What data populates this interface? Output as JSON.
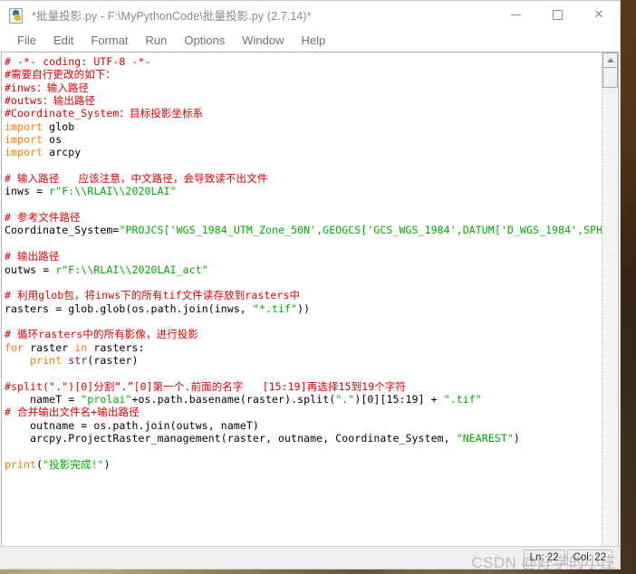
{
  "window": {
    "title": "*批量投影.py - F:\\MyPythonCode\\批量投影.py (2.7.14)*",
    "app_icon": "python-file-icon",
    "controls": {
      "minimize": "minimize-icon",
      "maximize": "maximize-icon",
      "close": "✕"
    }
  },
  "menubar": {
    "items": [
      {
        "label": "File"
      },
      {
        "label": "Edit"
      },
      {
        "label": "Format"
      },
      {
        "label": "Run"
      },
      {
        "label": "Options"
      },
      {
        "label": "Window"
      },
      {
        "label": "Help"
      }
    ]
  },
  "editor": {
    "lines": [
      [
        {
          "t": "# -*- coding: UTF-8 -*-",
          "c": "c-com"
        }
      ],
      [
        {
          "t": "#需要自行更改的如下：",
          "c": "c-com"
        }
      ],
      [
        {
          "t": "#inws：输入路径",
          "c": "c-com"
        }
      ],
      [
        {
          "t": "#outws：输出路径",
          "c": "c-com"
        }
      ],
      [
        {
          "t": "#Coordinate_System：目标投影坐标系",
          "c": "c-com"
        }
      ],
      [
        {
          "t": "import",
          "c": "c-kw"
        },
        {
          "t": " glob",
          "c": "c-def"
        }
      ],
      [
        {
          "t": "import",
          "c": "c-kw"
        },
        {
          "t": " os",
          "c": "c-def"
        }
      ],
      [
        {
          "t": "import",
          "c": "c-kw"
        },
        {
          "t": " arcpy",
          "c": "c-def"
        }
      ],
      [
        {
          "t": "",
          "c": "c-def"
        }
      ],
      [
        {
          "t": "# 输入路径   应该注意，中文路径，会导致读不出文件",
          "c": "c-com"
        }
      ],
      [
        {
          "t": "inws = ",
          "c": "c-def"
        },
        {
          "t": "r\"F:\\\\RLAI\\\\2020LAI\"",
          "c": "c-str"
        }
      ],
      [
        {
          "t": "",
          "c": "c-def"
        }
      ],
      [
        {
          "t": "# 参考文件路径",
          "c": "c-com"
        }
      ],
      [
        {
          "t": "Coordinate_System=",
          "c": "c-def"
        },
        {
          "t": "\"PROJCS['WGS_1984_UTM_Zone_50N',GEOGCS['GCS_WGS_1984',DATUM['D_WGS_1984',SPH",
          "c": "c-str"
        }
      ],
      [
        {
          "t": "",
          "c": "c-def"
        }
      ],
      [
        {
          "t": "# 输出路径",
          "c": "c-com"
        }
      ],
      [
        {
          "t": "outws = ",
          "c": "c-def"
        },
        {
          "t": "r\"F:\\\\RLAI\\\\2020LAI_act\"",
          "c": "c-str"
        }
      ],
      [
        {
          "t": "",
          "c": "c-def"
        }
      ],
      [
        {
          "t": "# 利用glob包，将inws下的所有tif文件读存放到rasters中",
          "c": "c-com"
        }
      ],
      [
        {
          "t": "rasters = glob.glob(os.path.join(inws, ",
          "c": "c-def"
        },
        {
          "t": "\"*.tif\"",
          "c": "c-str"
        },
        {
          "t": "))",
          "c": "c-def"
        }
      ],
      [
        {
          "t": "",
          "c": "c-def"
        }
      ],
      [
        {
          "t": "# 循环rasters中的所有影像，进行投影",
          "c": "c-com"
        }
      ],
      [
        {
          "t": "for",
          "c": "c-kw"
        },
        {
          "t": " raster ",
          "c": "c-def"
        },
        {
          "t": "in",
          "c": "c-kw"
        },
        {
          "t": " rasters:",
          "c": "c-def"
        }
      ],
      [
        {
          "t": "    ",
          "c": "c-def"
        },
        {
          "t": "print",
          "c": "c-kw"
        },
        {
          "t": " ",
          "c": "c-def"
        },
        {
          "t": "str",
          "c": "c-bi"
        },
        {
          "t": "(raster)",
          "c": "c-def"
        }
      ],
      [
        {
          "t": "",
          "c": "c-def"
        }
      ],
      [
        {
          "t": "#split(\".\")[0]分割“.”[0]第一个.前面的名字   [15:19]再选择15到19个字符",
          "c": "c-com"
        }
      ],
      [
        {
          "t": "    nameT = ",
          "c": "c-def"
        },
        {
          "t": "\"prolai\"",
          "c": "c-str"
        },
        {
          "t": "+os.path.basename(raster).split(",
          "c": "c-def"
        },
        {
          "t": "\".\"",
          "c": "c-str"
        },
        {
          "t": ")[0][15:19] + ",
          "c": "c-def"
        },
        {
          "t": "\".tif\"",
          "c": "c-str"
        }
      ],
      [
        {
          "t": "# 合并输出文件名+输出路径",
          "c": "c-com"
        }
      ],
      [
        {
          "t": "    outname = os.path.join(outws, nameT)",
          "c": "c-def"
        }
      ],
      [
        {
          "t": "    arcpy.ProjectRaster_management(raster, outname, Coordinate_System, ",
          "c": "c-def"
        },
        {
          "t": "\"NEAREST\"",
          "c": "c-str"
        },
        {
          "t": ")",
          "c": "c-def"
        }
      ],
      [
        {
          "t": "",
          "c": "c-def"
        }
      ],
      [
        {
          "t": "print",
          "c": "c-kw"
        },
        {
          "t": "(",
          "c": "c-def"
        },
        {
          "t": "\"投影完成!\"",
          "c": "c-str"
        },
        {
          "t": ")",
          "c": "c-def"
        }
      ]
    ]
  },
  "scrollbar": {
    "up_arrow": "scroll-up-arrow"
  },
  "statusbar": {
    "line_label": "Ln: 22",
    "col_label": "Col: 22"
  },
  "watermark": {
    "text": "CSDN @好学的小庄"
  },
  "colors": {
    "comment": "#dd0000",
    "string": "#00aa00",
    "keyword": "#ff7700",
    "builtin": "#900090",
    "title_text": "#8a8a8a",
    "menu_text": "#707070"
  }
}
